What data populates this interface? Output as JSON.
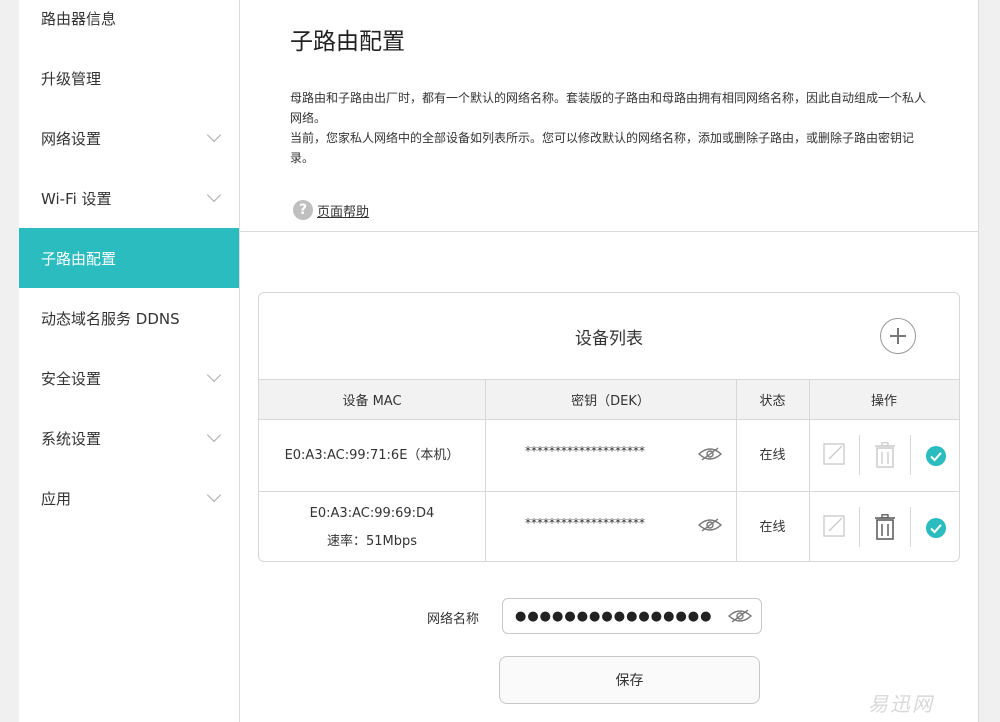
{
  "sidebar": {
    "items": [
      {
        "label": "路由器信息",
        "has_chevron": false
      },
      {
        "label": "升级管理",
        "has_chevron": false
      },
      {
        "label": "网络设置",
        "has_chevron": true
      },
      {
        "label": "Wi-Fi 设置",
        "has_chevron": true
      },
      {
        "label": "子路由配置",
        "has_chevron": false,
        "active": true
      },
      {
        "label": "动态域名服务 DDNS",
        "has_chevron": false
      },
      {
        "label": "安全设置",
        "has_chevron": true
      },
      {
        "label": "系统设置",
        "has_chevron": true
      },
      {
        "label": "应用",
        "has_chevron": true
      }
    ]
  },
  "main": {
    "title": "子路由配置",
    "desc_line1": "母路由和子路由出厂时，都有一个默认的网络名称。套装版的子路由和母路由拥有相同网络名称，因此自动组成一个私人网络。",
    "desc_line2": "当前，您家私人网络中的全部设备如列表所示。您可以修改默认的网络名称，添加或删除子路由，或删除子路由密钥记录。",
    "help_label": "页面帮助"
  },
  "table": {
    "title": "设备列表",
    "headers": {
      "mac": "设备 MAC",
      "dek": "密钥（DEK）",
      "status": "状态",
      "ops": "操作"
    },
    "rows": [
      {
        "mac": "E0:A3:AC:99:71:6E（本机）",
        "sub": "",
        "dek": "********************",
        "status": "在线"
      },
      {
        "mac": "E0:A3:AC:99:69:D4",
        "sub": "速率：51Mbps",
        "dek": "********************",
        "status": "在线"
      }
    ]
  },
  "network": {
    "label": "网络名称",
    "value": "●●●●●●●●●●●●●●●●"
  },
  "save_label": "保存",
  "watermark": "易迅网",
  "colors": {
    "accent": "#2bbcc0",
    "check": "#2bbcc0"
  }
}
